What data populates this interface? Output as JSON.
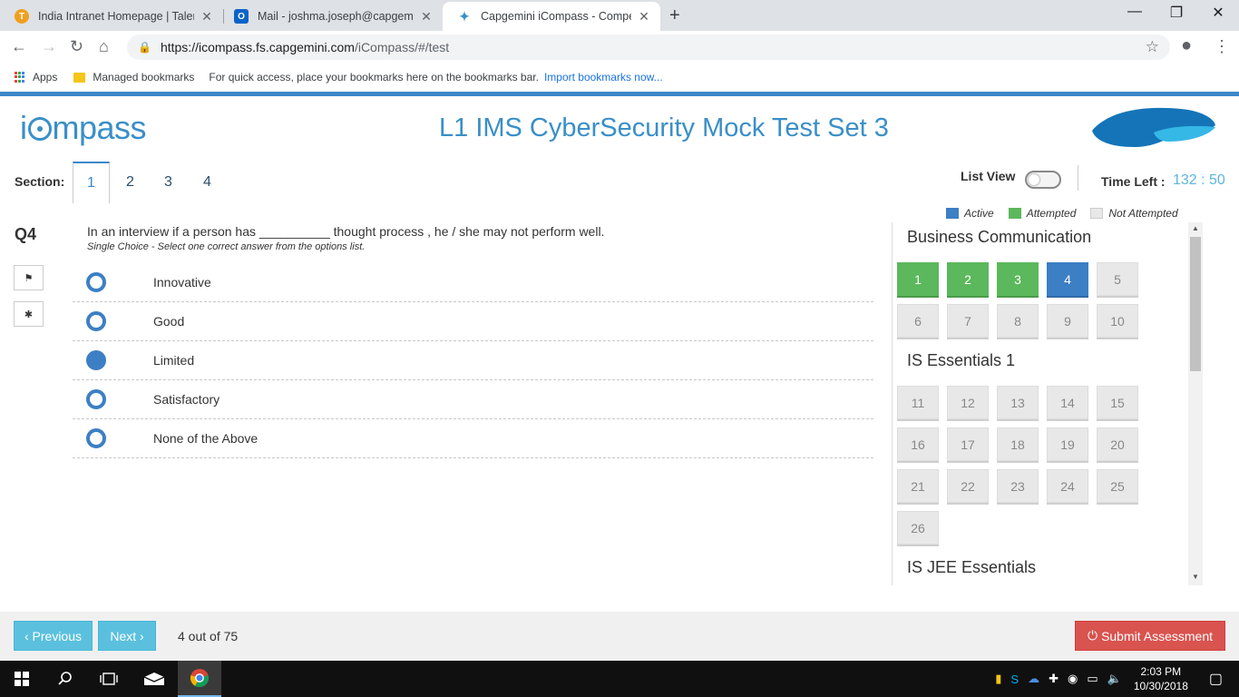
{
  "browser": {
    "tabs": [
      {
        "title": "India Intranet Homepage | Talent",
        "icon": "intranet-icon"
      },
      {
        "title": "Mail - joshma.joseph@capgemin",
        "icon": "outlook-icon"
      },
      {
        "title": "Capgemini iCompass - Compete",
        "icon": "compass-icon"
      }
    ],
    "url_domain": "https://icompass.fs.capgemini.com",
    "url_path": "/iCompass/#/test",
    "bookmarks": {
      "apps": "Apps",
      "managed": "Managed bookmarks",
      "hint": "For quick access, place your bookmarks here on the bookmarks bar.",
      "import_link": "Import bookmarks now..."
    }
  },
  "app": {
    "logo_pre": "i",
    "logo_post": "mpass",
    "test_title": "L1 IMS CyberSecurity Mock Test Set 3",
    "section_label": "Section:",
    "sections": [
      "1",
      "2",
      "3",
      "4"
    ],
    "active_section": "1",
    "list_view_label": "List View",
    "time_left_label": "Time Left :",
    "time_left": "132 : 50"
  },
  "question": {
    "number": "Q4",
    "text": "In an interview if a person has __________ thought process , he / she may not perform well.",
    "hint": "Single Choice - Select one correct answer from the options list.",
    "options": [
      "Innovative",
      "Good",
      "Limited",
      "Satisfactory",
      "None of the Above"
    ],
    "selected_index": 2
  },
  "legend": {
    "active": "Active",
    "attempted": "Attempted",
    "not_attempted": "Not Attempted",
    "colors": {
      "active": "#3c7fc5",
      "attempted": "#5cb85c",
      "not_attempted": "#e8e8e8"
    }
  },
  "palette": {
    "groups": [
      {
        "title": "Business Communication",
        "questions": [
          "1",
          "2",
          "3",
          "4",
          "5",
          "6",
          "7",
          "8",
          "9",
          "10"
        ]
      },
      {
        "title": "IS Essentials 1",
        "questions": [
          "11",
          "12",
          "13",
          "14",
          "15",
          "16",
          "17",
          "18",
          "19",
          "20",
          "21",
          "22",
          "23",
          "24",
          "25",
          "26"
        ]
      },
      {
        "title": "IS JEE Essentials",
        "questions": []
      }
    ],
    "attempted": [
      "1",
      "2",
      "3"
    ],
    "active": "4"
  },
  "footer": {
    "previous": "‹ Previous",
    "next": "Next ›",
    "progress": "4 out of 75",
    "submit": "Submit Assessment"
  },
  "taskbar": {
    "time": "2:03 PM",
    "date": "10/30/2018"
  }
}
